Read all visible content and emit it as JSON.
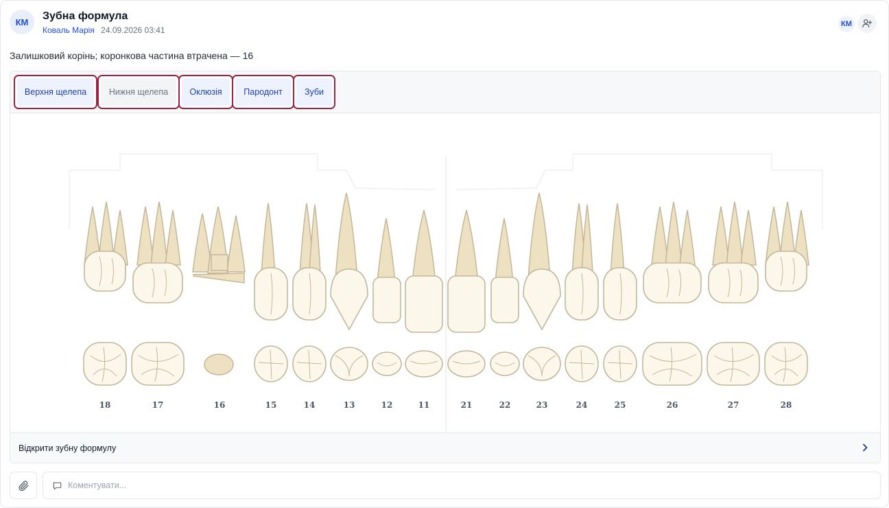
{
  "post": {
    "avatar_initials": "КМ",
    "title": "Зубна формула",
    "author": "Коваль Марія",
    "timestamp": "24.09.2026 03:41",
    "description": "Залишковий корінь; коронкова частина втрачена — 16"
  },
  "header_right": {
    "participant_initials": "КМ",
    "add_participant_icon": "user-plus-icon"
  },
  "tabs": [
    {
      "label": "Верхня щелепа",
      "state": "active"
    },
    {
      "label": "Нижня щелепа",
      "state": "inactive"
    },
    {
      "label": "Оклюзія",
      "state": "active"
    },
    {
      "label": "Пародонт",
      "state": "active"
    },
    {
      "label": "Зуби",
      "state": "active"
    }
  ],
  "teeth": {
    "numbers": [
      "18",
      "17",
      "16",
      "15",
      "14",
      "13",
      "12",
      "11",
      "21",
      "22",
      "23",
      "24",
      "25",
      "26",
      "27",
      "28"
    ],
    "residual_root_tooth": "16"
  },
  "open_formula": {
    "label": "Відкрити зубну формулу",
    "icon": "chevron-right-icon"
  },
  "composer": {
    "attach_icon": "paperclip-icon",
    "comment_icon": "speech-bubble-icon",
    "placeholder": "Коментувати..."
  },
  "colors": {
    "accent": "#1d4ed8",
    "tab_border": "#9b2340",
    "root_fill": "#ede1c1",
    "crown_fill": "#fbf7ea",
    "tooth_stroke": "#c2b79a"
  }
}
